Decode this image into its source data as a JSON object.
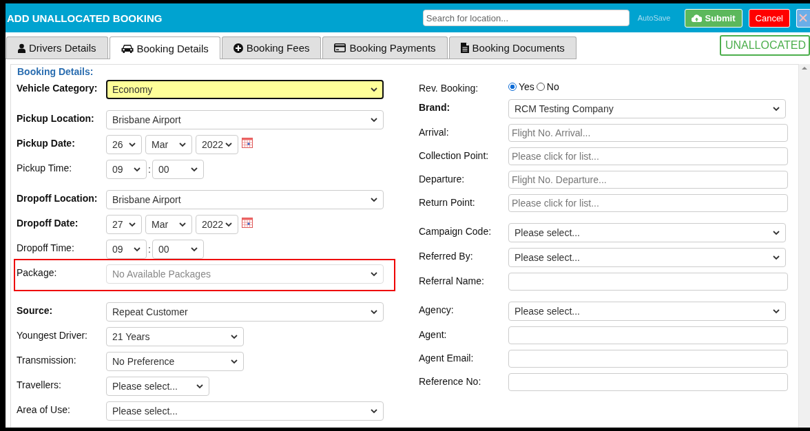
{
  "window": {
    "title": "ADD UNALLOCATED BOOKING"
  },
  "header": {
    "search": {
      "placeholder": "Search for location..."
    },
    "autosave": "AutoSave",
    "buttons": [
      {
        "kind": "submit",
        "label": "Submit"
      },
      {
        "kind": "cancel",
        "label": "Cancel"
      },
      {
        "kind": "close"
      }
    ]
  },
  "tabs": [
    {
      "label": "Drivers Details",
      "selected": false
    },
    {
      "label": "Booking Details",
      "selected": true
    },
    {
      "label": "Booking Fees",
      "selected": false
    },
    {
      "label": "Booking Payments",
      "selected": false
    },
    {
      "label": "Booking Documents",
      "selected": false
    }
  ],
  "status_badge": "UNALLOCATED",
  "section_title": "Booking Details:",
  "left_groups": [
    [
      {
        "label": "Vehicle Category:",
        "bold": true,
        "kind": "select",
        "value": "Economy",
        "highlighted": true
      }
    ],
    [
      {
        "label": "Pickup Location:",
        "bold": true,
        "kind": "select",
        "value": "Brisbane Airport"
      },
      {
        "label": "Pickup Date:",
        "bold": true,
        "kind": "date",
        "day": "26",
        "month": "Mar",
        "year": "2022"
      },
      {
        "label": "Pickup Time:",
        "bold": false,
        "kind": "time",
        "hour": "09",
        "separator": ":",
        "minute": "00"
      }
    ],
    [
      {
        "label": "Dropoff Location:",
        "bold": true,
        "kind": "select",
        "value": "Brisbane Airport"
      },
      {
        "label": "Dropoff Date:",
        "bold": true,
        "kind": "date",
        "day": "27",
        "month": "Mar",
        "year": "2022"
      },
      {
        "label": "Dropoff Time:",
        "bold": false,
        "kind": "time",
        "hour": "09",
        "separator": ":",
        "minute": "00"
      },
      {
        "label": "Package:",
        "bold": false,
        "kind": "select",
        "value": "No Available Packages",
        "disabled": true,
        "flagged": true
      }
    ],
    [
      {
        "label": "Source:",
        "bold": true,
        "kind": "select",
        "value": "Repeat Customer"
      },
      {
        "label": "Youngest Driver:",
        "bold": false,
        "kind": "midselect",
        "value": "21 Years"
      },
      {
        "label": "Transmission:",
        "bold": false,
        "kind": "midselect",
        "value": "No Preference"
      },
      {
        "label": "Travellers:",
        "bold": false,
        "kind": "smallselect",
        "value": "Please select..."
      },
      {
        "label": "Area of Use:",
        "bold": false,
        "kind": "select",
        "value": "Please select..."
      }
    ]
  ],
  "right_groups": [
    [
      {
        "label": "Rev. Booking:",
        "bold": false,
        "kind": "radio",
        "options": [
          {
            "label": "Yes",
            "selected": true
          },
          {
            "label": "No",
            "selected": false
          }
        ]
      },
      {
        "label": "Brand:",
        "bold": true,
        "kind": "select",
        "value": "RCM Testing Company"
      },
      {
        "label": "Arrival:",
        "bold": false,
        "kind": "input",
        "placeholder": "Flight No. Arrival..."
      },
      {
        "label": "Collection Point:",
        "bold": false,
        "kind": "input",
        "placeholder": "Please click for list..."
      },
      {
        "label": "Departure:",
        "bold": false,
        "kind": "input",
        "placeholder": "Flight No. Departure..."
      },
      {
        "label": "Return Point:",
        "bold": false,
        "kind": "input",
        "placeholder": "Please click for list..."
      }
    ],
    [
      {
        "label": "Campaign Code:",
        "bold": false,
        "kind": "select",
        "value": "Please select..."
      },
      {
        "label": "Referred By:",
        "bold": false,
        "kind": "select",
        "value": "Please select..."
      },
      {
        "label": "Referral Name:",
        "bold": false,
        "kind": "input"
      }
    ],
    [
      {
        "label": "Agency:",
        "bold": false,
        "kind": "select",
        "value": "Please select..."
      },
      {
        "label": "Agent:",
        "bold": false,
        "kind": "input"
      },
      {
        "label": "Agent Email:",
        "bold": false,
        "kind": "input"
      },
      {
        "label": "Reference No:",
        "bold": false,
        "kind": "input"
      }
    ]
  ]
}
